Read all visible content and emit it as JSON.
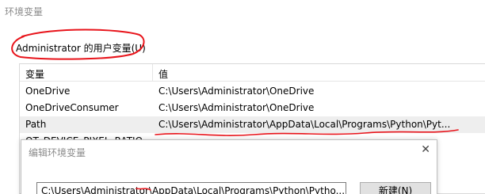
{
  "window": {
    "title": "环境变量"
  },
  "user_vars": {
    "group_label": "Administrator 的用户变量(U)",
    "columns": [
      "变量",
      "值"
    ],
    "rows": [
      {
        "name": "OneDrive",
        "value": "C:\\Users\\Administrator\\OneDrive"
      },
      {
        "name": "OneDriveConsumer",
        "value": "C:\\Users\\Administrator\\OneDrive"
      },
      {
        "name": "Path",
        "value": "C:\\Users\\Administrator\\AppData\\Local\\Programs\\Python\\Pyt..."
      },
      {
        "name": "QT_DEVICE_PIXEL_RATIO",
        "value": ""
      }
    ]
  },
  "edit_dialog": {
    "title": "编辑环境变量",
    "close_glyph": "✕",
    "path_value": "C:\\Users\\Administrator\\AppData\\Local\\Programs\\Python\\Pytho...",
    "new_button": "新建(N)"
  },
  "colors": {
    "annotation": "#e8141b",
    "selected_row": "#eeeeee",
    "title_text": "#8c8c8c"
  }
}
